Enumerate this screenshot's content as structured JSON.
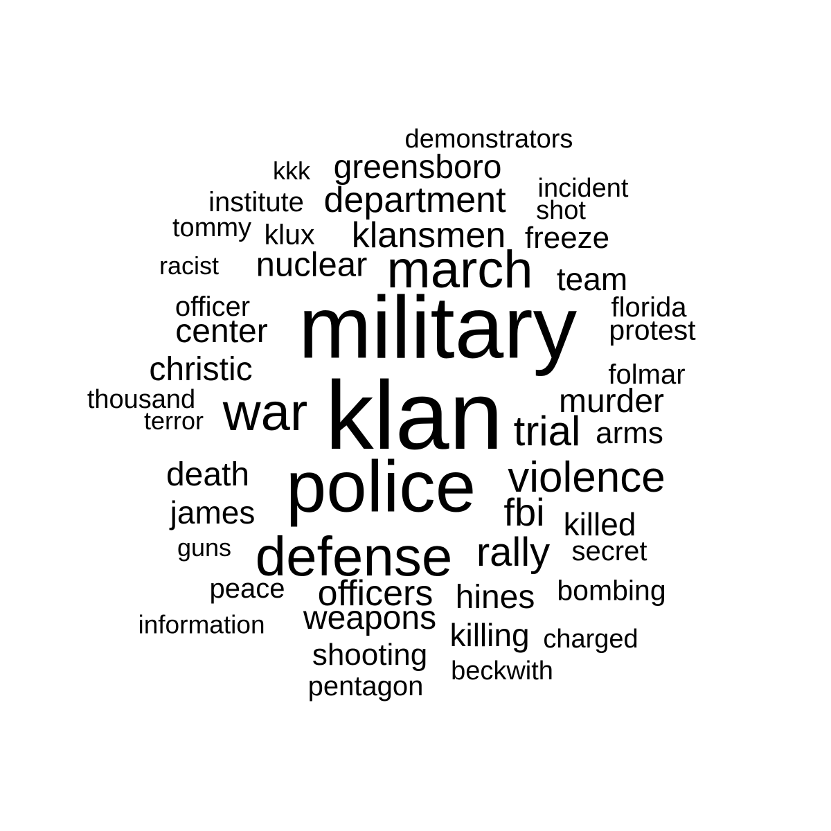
{
  "words": [
    "klan",
    "military",
    "police",
    "defense",
    "march",
    "war",
    "violence",
    "klansmen",
    "department",
    "greensboro",
    "nuclear",
    "center",
    "christic",
    "murder",
    "trial",
    "fbi",
    "rally",
    "officers",
    "weapons",
    "hines",
    "death",
    "james",
    "killing",
    "shooting",
    "killed",
    "team",
    "arms",
    "freeze",
    "protest",
    "klux",
    "institute",
    "officer",
    "folmar",
    "florida",
    "bombing",
    "pentagon",
    "secret",
    "thousand",
    "demonstrators",
    "incident",
    "shot",
    "charged",
    "beckwith",
    "peace",
    "tommy",
    "racist",
    "terror",
    "guns",
    "information",
    "kkk"
  ],
  "colors": {
    "text": "#000000",
    "background": "#ffffff"
  }
}
